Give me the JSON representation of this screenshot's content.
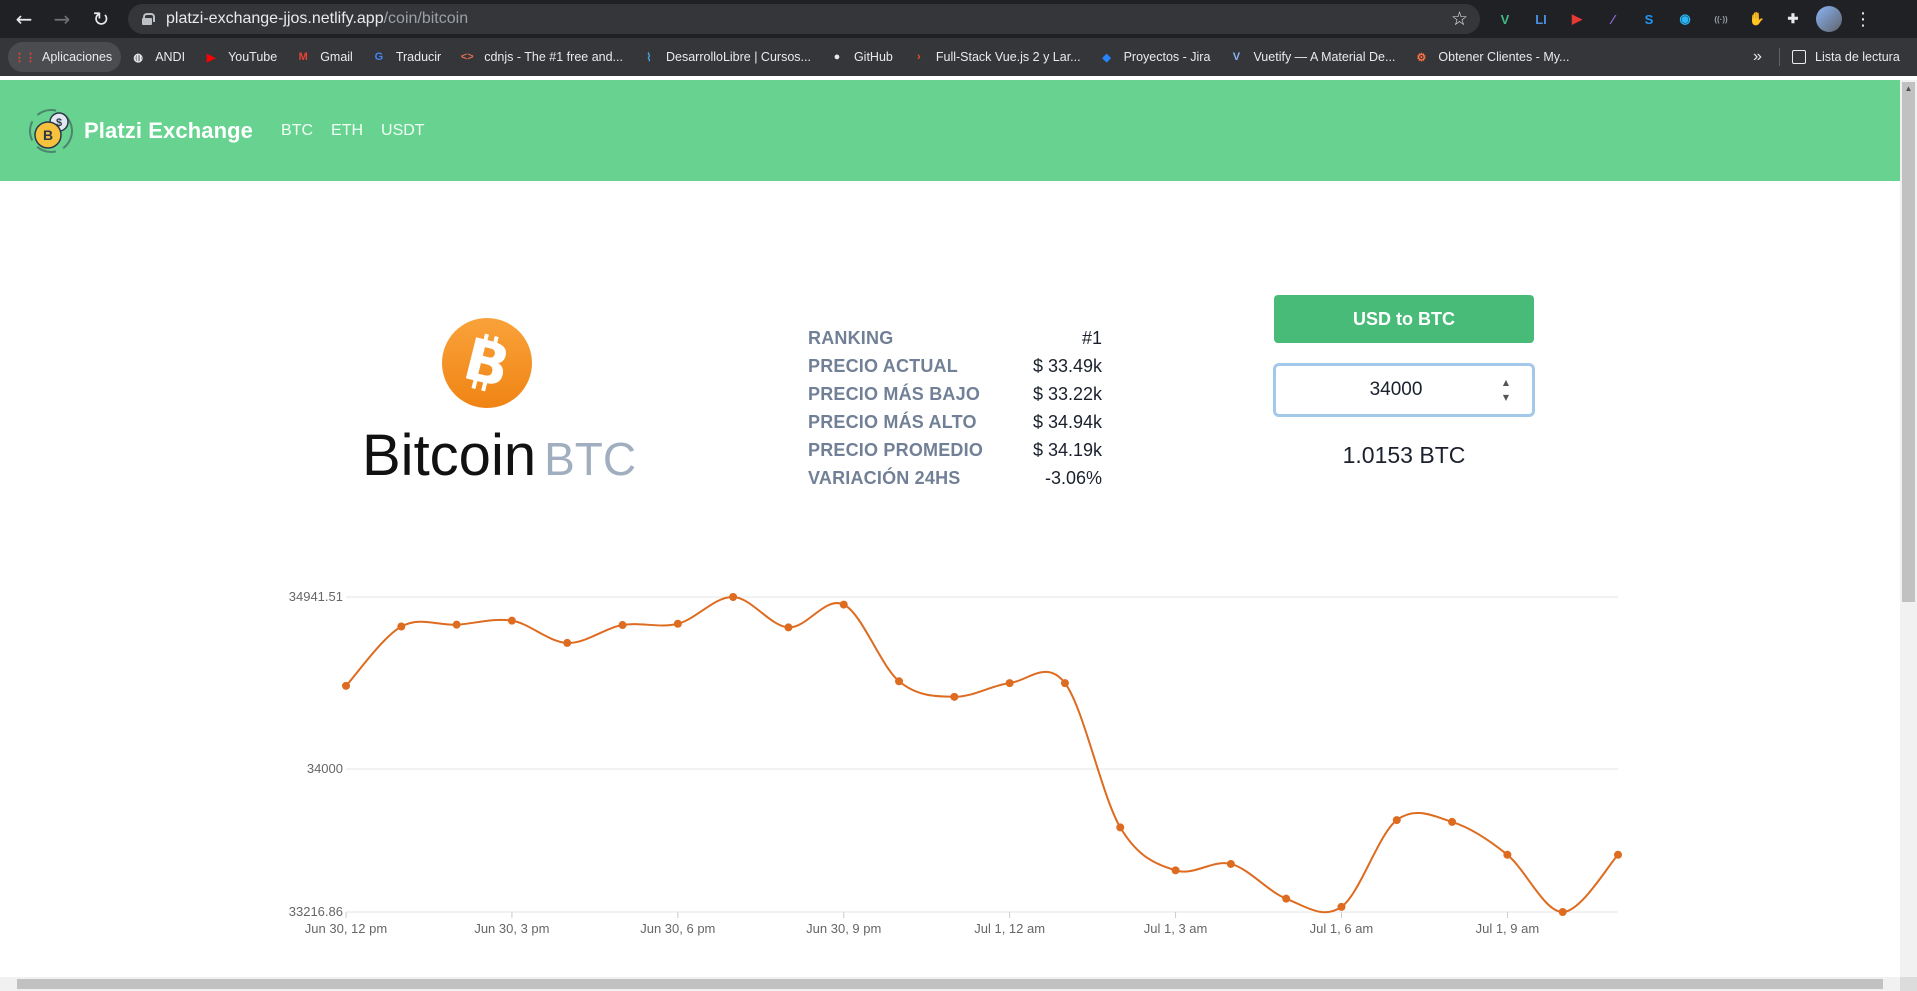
{
  "browser": {
    "url_host": "platzi-exchange-jjos.netlify.app",
    "url_path": "/coin/bitcoin",
    "extensions": [
      {
        "name": "vue-devtools-icon",
        "glyph": "V",
        "color": "#41b883"
      },
      {
        "name": "li-extension-icon",
        "glyph": "LI",
        "color": "#4a90e2"
      },
      {
        "name": "red-extension-icon",
        "glyph": "▶",
        "color": "#e53935"
      },
      {
        "name": "feather-extension-icon",
        "glyph": "∕",
        "color": "#9c6ade"
      },
      {
        "name": "s-extension-icon",
        "glyph": "S",
        "color": "#2196f3"
      },
      {
        "name": "blue-circle-extension-icon",
        "glyph": "◉",
        "color": "#29b6f6"
      },
      {
        "name": "radio-extension-icon",
        "glyph": "((·))",
        "color": "#9aa0a6"
      },
      {
        "name": "stop-hand-extension-icon",
        "glyph": "✋",
        "color": "#e53935"
      },
      {
        "name": "puzzle-icon",
        "glyph": "✚",
        "color": "#e8eaed"
      }
    ],
    "bookmarks": [
      {
        "label": "Aplicaciones",
        "icon": "apps-grid-icon",
        "color": "#ea4335",
        "glyph": "⋮⋮",
        "active": true
      },
      {
        "label": "ANDI",
        "icon": "globe-icon",
        "color": "#e8eaed",
        "glyph": "◍"
      },
      {
        "label": "YouTube",
        "icon": "youtube-icon",
        "color": "#ff0000",
        "glyph": "▶"
      },
      {
        "label": "Gmail",
        "icon": "gmail-icon",
        "color": "#ea4335",
        "glyph": "M"
      },
      {
        "label": "Traducir",
        "icon": "translate-icon",
        "color": "#4285f4",
        "glyph": "G"
      },
      {
        "label": "cdnjs - The #1 free and...",
        "icon": "code-icon",
        "color": "#e06c4c",
        "glyph": "<>"
      },
      {
        "label": "DesarrolloLibre | Cursos...",
        "icon": "desarrollolibre-icon",
        "color": "#4a9fd8",
        "glyph": "⌇"
      },
      {
        "label": "GitHub",
        "icon": "github-icon",
        "color": "#e8eaed",
        "glyph": "●"
      },
      {
        "label": "Full-Stack Vue.js 2 y Lar...",
        "icon": "udemy-icon",
        "color": "#f4511e",
        "glyph": "›"
      },
      {
        "label": "Proyectos - Jira",
        "icon": "jira-icon",
        "color": "#2684ff",
        "glyph": "◆"
      },
      {
        "label": "Vuetify — A Material De...",
        "icon": "vuetify-icon",
        "color": "#8ab4f8",
        "glyph": "V"
      },
      {
        "label": "Obtener Clientes - My...",
        "icon": "hubspot-icon",
        "color": "#ff7043",
        "glyph": "⚙"
      }
    ],
    "more": "»",
    "reading_list": "Lista de lectura"
  },
  "header": {
    "brand": "Platzi Exchange",
    "links": [
      "BTC",
      "ETH",
      "USDT"
    ],
    "colors": {
      "bar": "#68d391",
      "logo_coin": "#f6c23e"
    }
  },
  "coin": {
    "name": "Bitcoin",
    "symbol": "BTC",
    "icon": "bitcoin-icon",
    "icon_color": "#f7931a"
  },
  "stats": [
    {
      "label": "RANKING",
      "value": "#1"
    },
    {
      "label": "PRECIO ACTUAL",
      "value": "$ 33.49k"
    },
    {
      "label": "PRECIO MÁS BAJO",
      "value": "$ 33.22k"
    },
    {
      "label": "PRECIO MÁS ALTO",
      "value": "$ 34.94k"
    },
    {
      "label": "PRECIO PROMEDIO",
      "value": "$ 34.19k"
    },
    {
      "label": "VARIACIÓN 24HS",
      "value": "-3.06%"
    }
  ],
  "converter": {
    "button_label": "USD to BTC",
    "input_value": "34000",
    "result": "1.0153 BTC",
    "button_color": "#48bb78"
  },
  "chart_data": {
    "type": "line",
    "title": "",
    "xlabel": "",
    "ylabel": "",
    "color": "#dd6b20",
    "ylim": [
      33216.86,
      34941.51
    ],
    "yticks": [
      "34941.51",
      "34000",
      "33216.86"
    ],
    "yticks_values": [
      34941.51,
      34000,
      33216.86
    ],
    "xticks": [
      "Jun 30, 12 pm",
      "Jun 30, 3 pm",
      "Jun 30, 6 pm",
      "Jun 30, 9 pm",
      "Jul 1, 12 am",
      "Jul 1, 3 am",
      "Jul 1, 6 am",
      "Jul 1, 9 am"
    ],
    "xticks_hours": [
      0,
      3,
      6,
      9,
      12,
      15,
      18,
      21
    ],
    "x_hours": [
      0,
      1,
      2,
      3,
      4,
      5,
      6,
      7,
      8,
      9,
      10,
      11,
      12,
      13,
      14,
      15,
      16,
      17,
      18,
      19,
      20,
      21,
      22,
      23
    ],
    "values": [
      34455,
      34780,
      34790,
      34812,
      34690,
      34788,
      34795,
      34941.51,
      34775,
      34900,
      34480,
      34395,
      34470,
      34470,
      33680,
      33445,
      33480,
      33290,
      33245,
      33720,
      33710,
      33530,
      33216.86,
      33530
    ],
    "xlim_hours": [
      0,
      23
    ],
    "grid": true
  }
}
